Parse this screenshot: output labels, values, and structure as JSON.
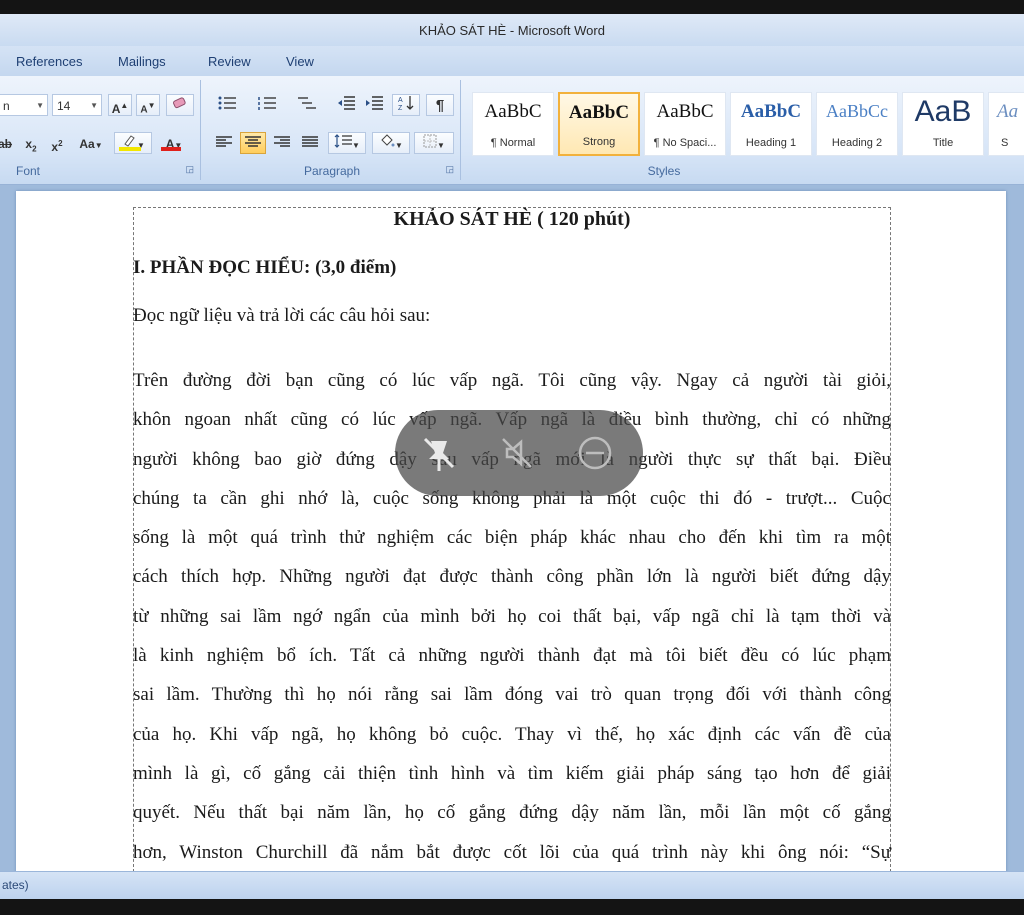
{
  "window": {
    "title": "KHẢO SÁT HÈ - Microsoft Word"
  },
  "tabs": [
    "References",
    "Mailings",
    "Review",
    "View"
  ],
  "ribbon": {
    "font": {
      "group_label": "Font",
      "font_name": "n",
      "font_size": "14",
      "grow_label": "A",
      "shrink_label": "A",
      "change_case_label": "Aa",
      "highlight_color": "#f2e600",
      "font_color": "#e0201b"
    },
    "paragraph": {
      "group_label": "Paragraph",
      "pilcrow": "¶"
    },
    "styles": {
      "group_label": "Styles",
      "items": [
        {
          "sample": "AaBbC",
          "name": "¶ Normal"
        },
        {
          "sample": "AaBbC",
          "name": "Strong"
        },
        {
          "sample": "AaBbC",
          "name": "¶ No Spaci..."
        },
        {
          "sample": "AaBbC",
          "name": "Heading 1"
        },
        {
          "sample": "AaBbCc",
          "name": "Heading 2"
        },
        {
          "sample": "AaB",
          "name": "Title"
        },
        {
          "sample": "Aa",
          "name": "S"
        }
      ]
    }
  },
  "document": {
    "title": "KHẢO SÁT HÈ ( 120 phút)",
    "section": "I. PHẦN ĐỌC HIỂU: (3,0 điểm)",
    "intro": "Đọc ngữ liệu và trả lời các câu hỏi sau:",
    "lines": [
      "Trên đường đời bạn cũng có lúc vấp ngã. Tôi cũng vậy. Ngay cả người tài giỏi,",
      "khôn ngoan nhất cũng có lúc vấp ngã. Vấp ngã là điều bình thường, chỉ có những",
      "người không bao giờ đứng dậy sau vấp ngã mới là người thực sự thất bại. Điều",
      "chúng ta cần ghi nhớ là, cuộc sống không phải là một cuộc thi đó - trượt... Cuộc",
      "sống là một quá trình thử nghiệm các biện pháp khác nhau cho đến khi tìm ra một",
      "cách thích hợp. Những người đạt được thành công phần lớn là người biết đứng dậy",
      "từ những sai lầm ngớ ngẩn của mình bởi họ coi thất bại, vấp ngã chỉ là tạm thời và",
      "là kinh nghiệm bổ ích. Tất cả những người thành đạt mà tôi biết đều có lúc phạm",
      "sai lầm. Thường thì họ nói rằng sai lầm đóng vai trò quan trọng đối với thành công",
      "của họ. Khi vấp ngã, họ không bỏ cuộc. Thay vì thế, họ xác định các vấn đề của",
      "mình là gì, cố gắng cải thiện tình hình và tìm kiếm giải pháp sáng tạo hơn để giải",
      "quyết. Nếu thất bại năm lần, họ cố gắng đứng dậy năm lần, mỗi lần một cố gắng",
      "hơn, Winston Churchill đã nắm bắt được cốt lõi của quá trình này khi ông nói: “Sự"
    ]
  },
  "status": {
    "text": "ates)"
  }
}
